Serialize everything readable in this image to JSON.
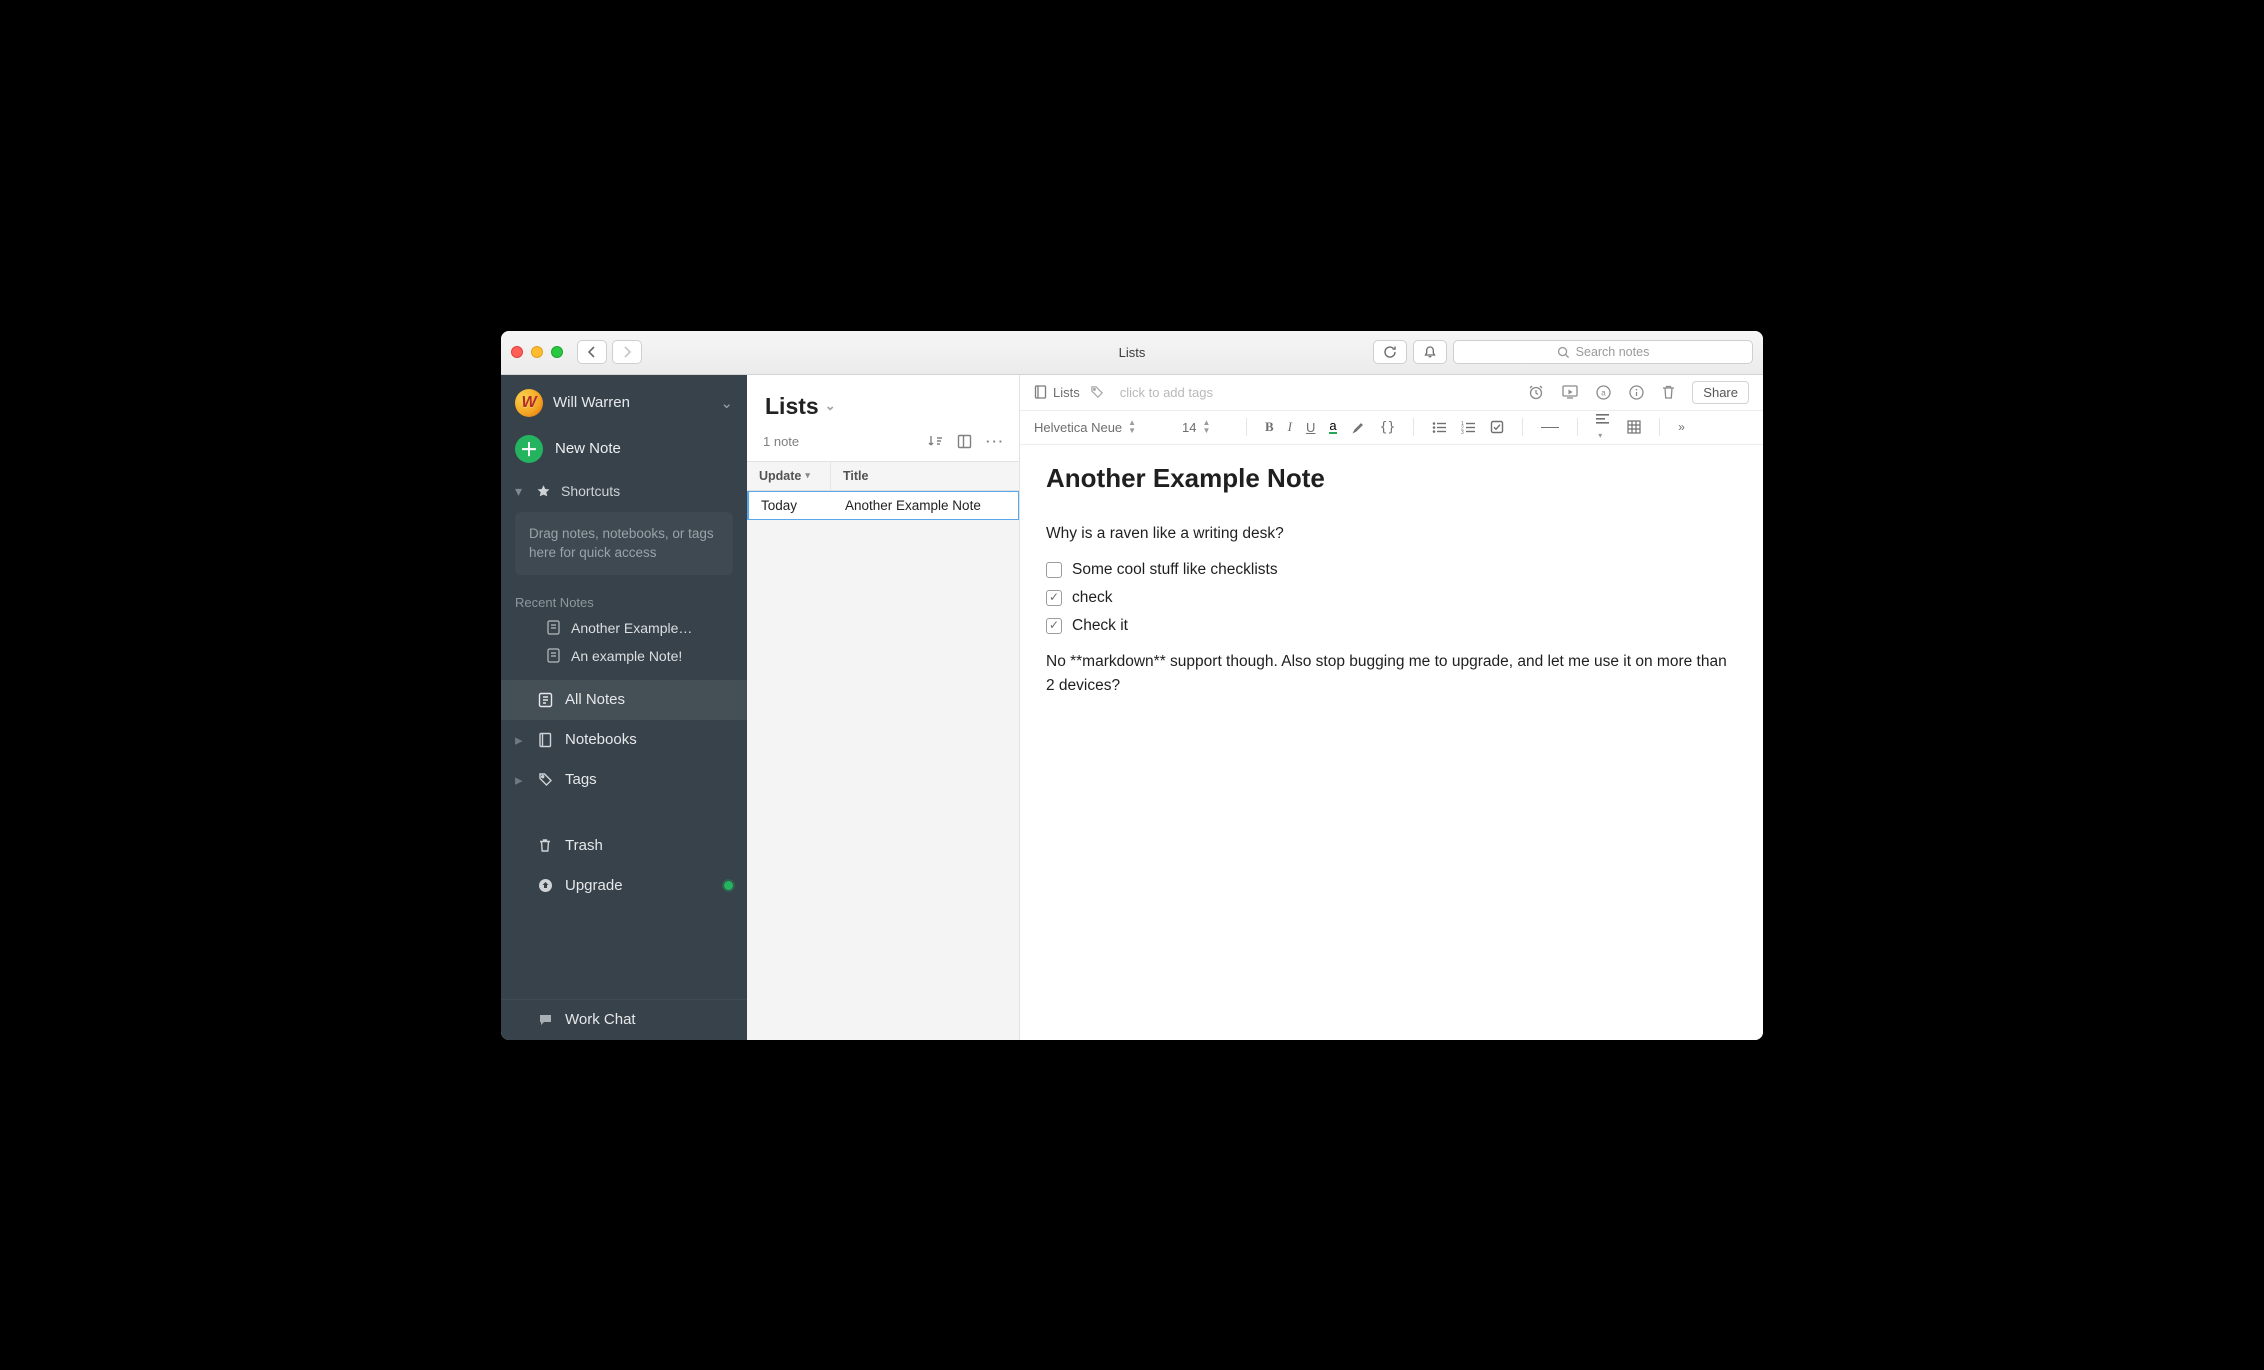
{
  "titlebar": {
    "title": "Lists"
  },
  "search": {
    "placeholder": "Search notes"
  },
  "sidebar": {
    "user": "Will Warren",
    "newNote": "New Note",
    "shortcuts": "Shortcuts",
    "shortcutsHint": "Drag notes, notebooks, or tags here for quick access",
    "recentLabel": "Recent Notes",
    "recent": [
      "Another Example…",
      "An example Note!"
    ],
    "allNotes": "All Notes",
    "notebooks": "Notebooks",
    "tags": "Tags",
    "trash": "Trash",
    "upgrade": "Upgrade",
    "workChat": "Work Chat"
  },
  "notelist": {
    "title": "Lists",
    "count": "1 note",
    "cols": {
      "update": "Update",
      "title": "Title"
    },
    "rows": [
      {
        "update": "Today",
        "title": "Another Example Note"
      }
    ]
  },
  "editor": {
    "crumb": "Lists",
    "tagsPlaceholder": "click to add tags",
    "share": "Share",
    "font": "Helvetica Neue",
    "fontSize": "14",
    "title": "Another Example Note",
    "para1": "Why is a raven like a writing desk?",
    "checks": [
      {
        "checked": false,
        "text": "Some cool stuff like checklists"
      },
      {
        "checked": true,
        "text": "check"
      },
      {
        "checked": true,
        "text": "Check it"
      }
    ],
    "para2": "No **markdown** support though. Also stop bugging me to upgrade, and let me use it on more than 2 devices?"
  }
}
